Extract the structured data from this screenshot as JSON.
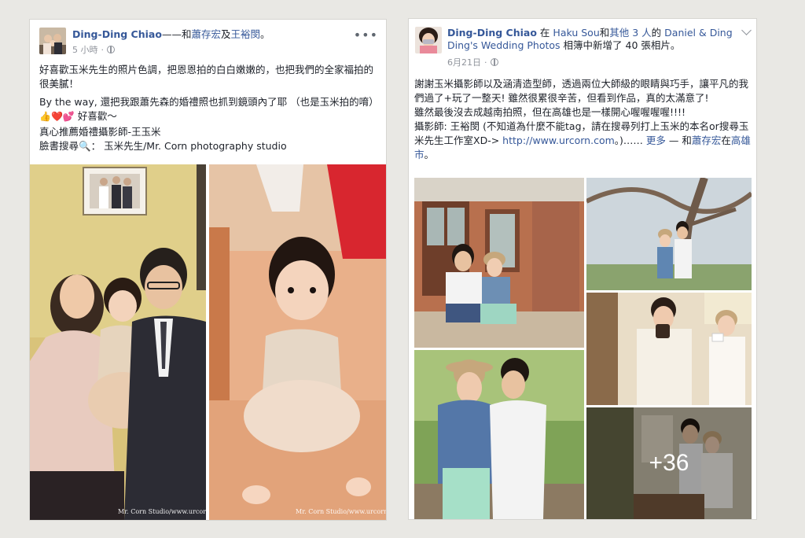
{
  "left_post": {
    "author": "Ding-Ding Chiao",
    "with_connector": "——和",
    "tag1": "蕭存宏",
    "and_word": "及",
    "tag2": "王裕閔",
    "period": "。",
    "time": "5 小時",
    "time_sep": "·",
    "more_label": "•••",
    "paragraph1": "好喜歡玉米先生的照片色調，把恩恩拍的白白嫩嫩的，也把我們的全家福拍的很美膩！",
    "paragraph2": "By the way, 還把我跟蕭先森的婚禮照也抓到鏡頭內了耶 （也是玉米拍的唷）",
    "emojis": "👍❤️💕",
    "paragraph2_end": "好喜歡～",
    "line3": "真心推薦婚禮攝影師-王玉米",
    "line4_prefix": "臉書搜尋",
    "line4_icon": "🔍",
    "line4_rest": "： 玉米先生/Mr. Corn photography studio",
    "watermark1": "Mr. Corn Studio/www.urcorn",
    "watermark2": "Mr. Corn Studio/www.urcorn"
  },
  "right_post": {
    "author": "Ding-Ding Chiao",
    "at": "在",
    "place": "Haku Sou",
    "and": "和",
    "others": "其他 3 人",
    "of": "的",
    "album_owner": "Daniel & Ding Ding's Wedding Photos",
    "added_text": "相簿中新增了 40 張相片。",
    "date": "6月21日",
    "time_sep": "·",
    "paragraph1": "謝謝玉米攝影師以及涵清造型師，透過兩位大師級的眼睛與巧手，讓平凡的我們過了+玩了一整天! 雖然很累很辛苦，但看到作品，真的太滿意了!",
    "paragraph2": "雖然最後沒去成越南拍照，但在高雄也是一樣開心喔喔喔喔!!!!",
    "paragraph3_prefix": "攝影師: 王裕閔 (不知道為什麼不能tag，請在搜尋列打上玉米的本名or搜尋玉米先生工作室XD-> ",
    "url": "http://www.urcorn.com",
    "paragraph3_suffix": "。)…… ",
    "more_link": "更多",
    "with_dash": " — 和",
    "tag": "蕭存宏",
    "in_word": "在",
    "city": "高雄市",
    "period": "。",
    "extra_count": "+36"
  },
  "colors": {
    "link": "#365899",
    "text": "#1d2129",
    "meta": "#90949c",
    "background": "#e9e8e4"
  }
}
